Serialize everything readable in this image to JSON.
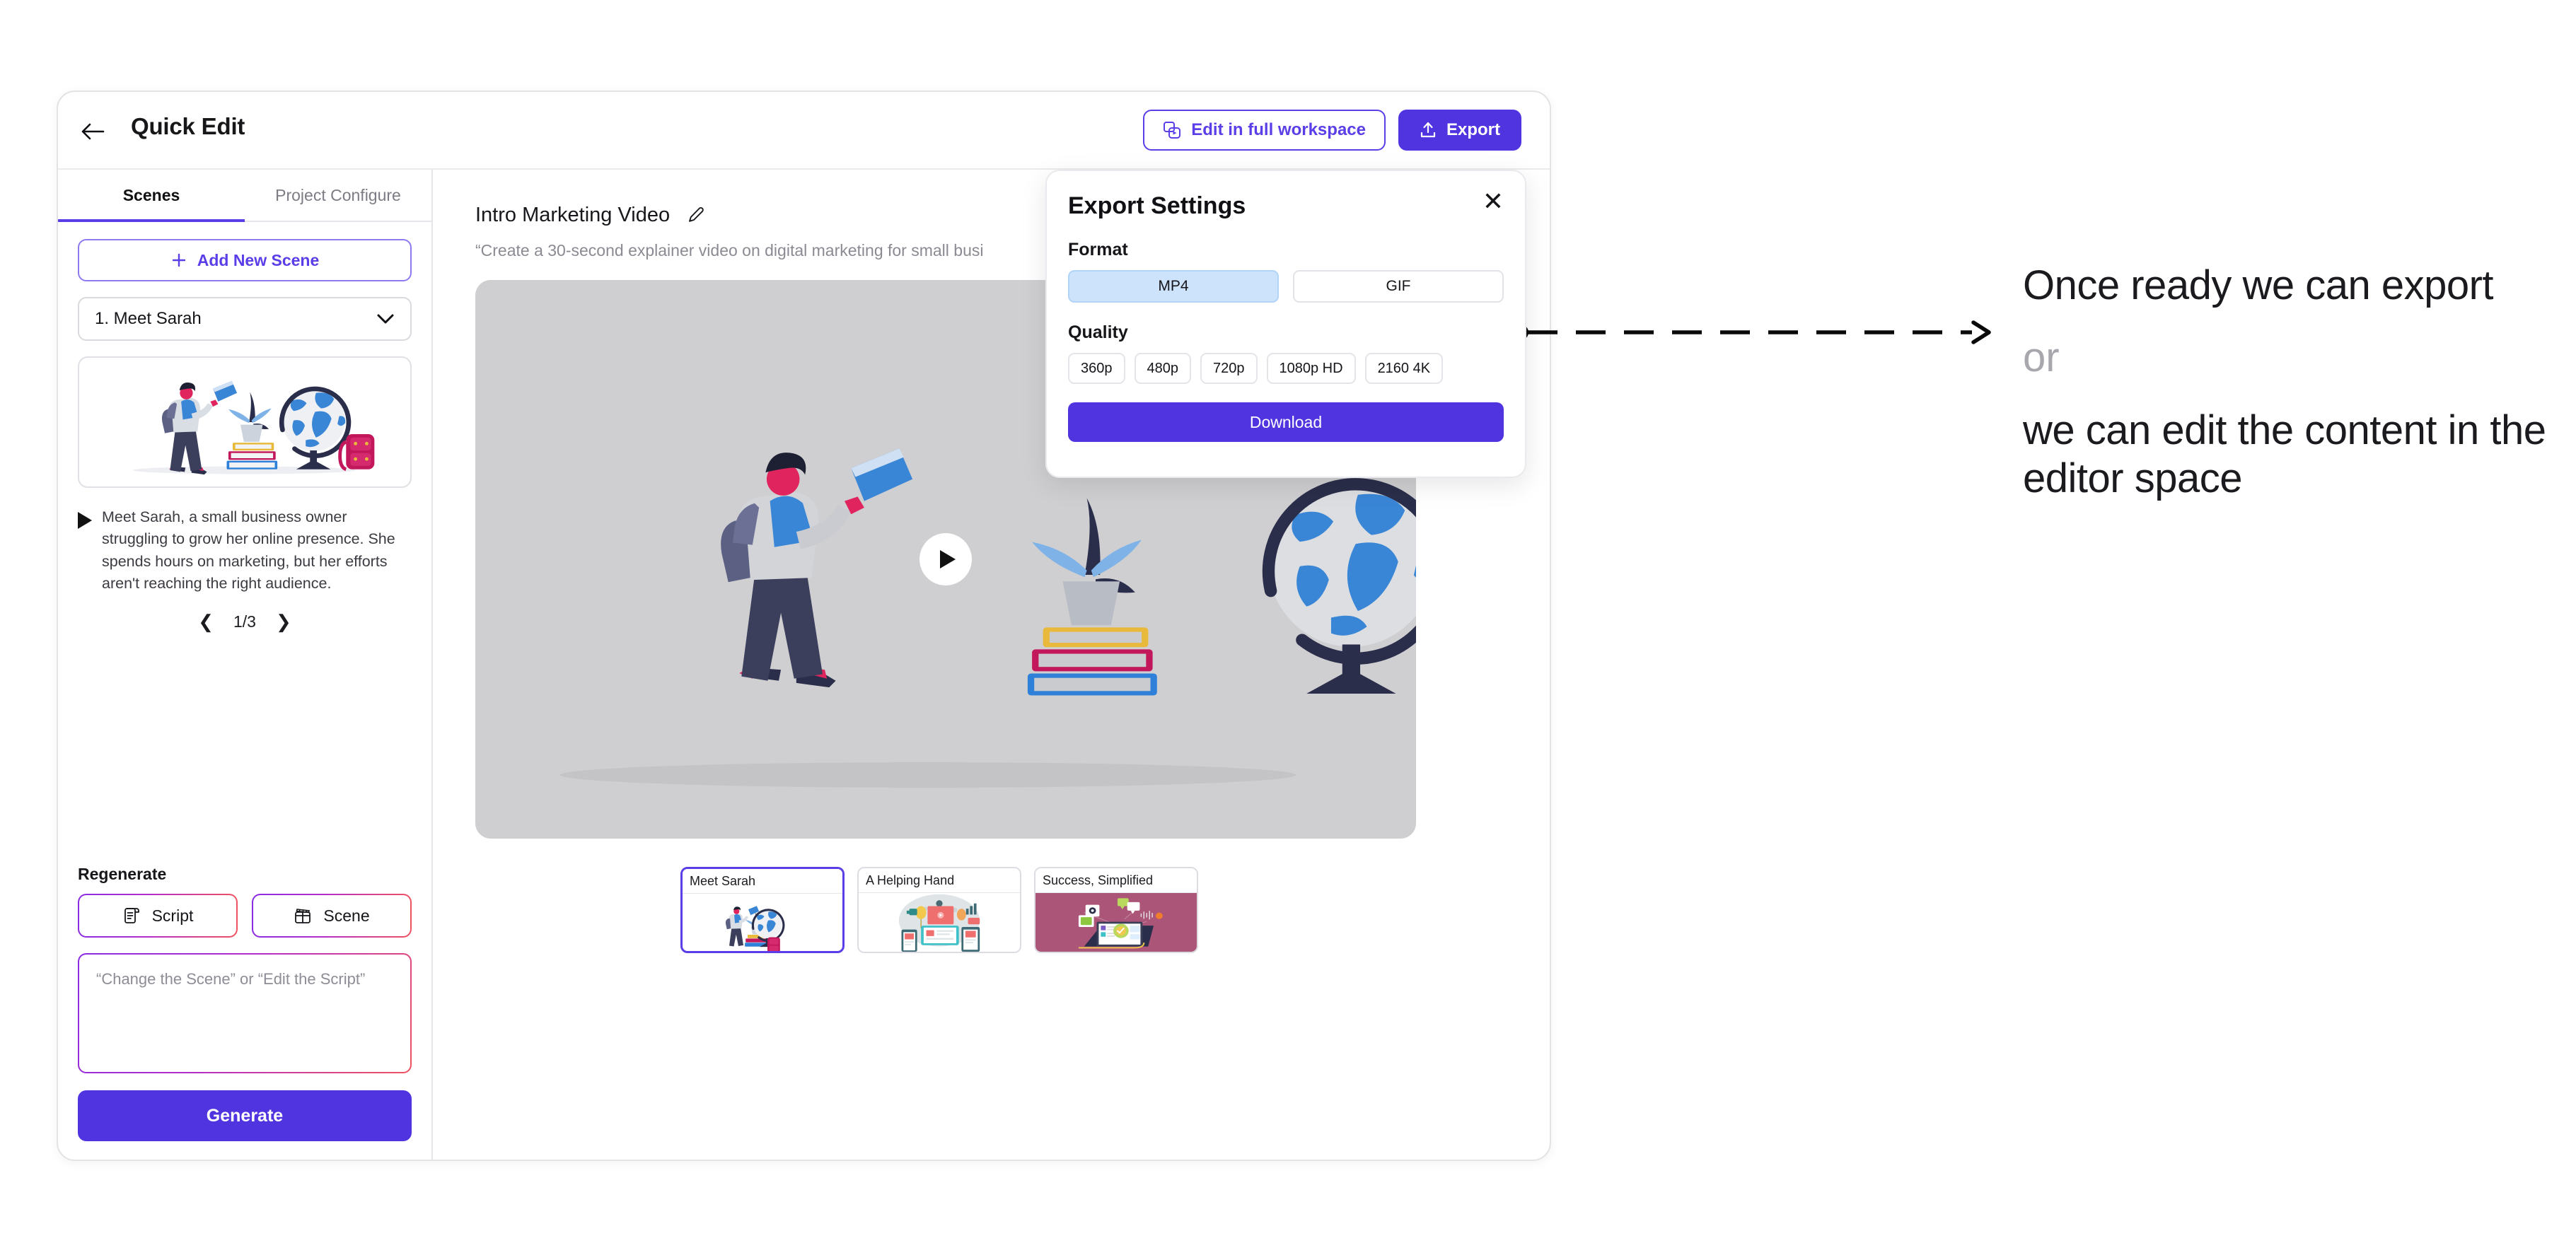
{
  "header": {
    "title": "Quick Edit",
    "back_icon": "arrow-left-icon",
    "edit_workspace_label": "Edit in full workspace",
    "edit_workspace_icon": "layers-play-icon",
    "export_label": "Export",
    "export_icon": "upload-icon"
  },
  "sidebar": {
    "tabs": [
      {
        "label": "Scenes",
        "active": true
      },
      {
        "label": "Project Configure",
        "active": false
      }
    ],
    "add_scene_label": "Add New Scene",
    "add_scene_icon": "plus-icon",
    "scene_select_value": "1. Meet Sarah",
    "scene_select_icon": "chevron-down-icon",
    "script_play_icon": "play-triangle-icon",
    "script_text": "Meet Sarah, a small business owner struggling to grow her online presence. She spends hours on marketing, but her efforts aren't reaching the right audience.",
    "pager": {
      "prev_icon": "chevron-left-icon",
      "next_icon": "chevron-right-icon",
      "counter": "1/3"
    },
    "regenerate_label": "Regenerate",
    "regen_buttons": [
      {
        "label": "Script",
        "icon": "script-scroll-icon"
      },
      {
        "label": "Scene",
        "icon": "clapperboard-icon"
      }
    ],
    "prompt_placeholder": "“Change the Scene” or “Edit the Script”",
    "generate_label": "Generate"
  },
  "stage": {
    "video_title": "Intro Marketing Video",
    "title_edit_icon": "pencil-edit-icon",
    "video_subtitle": "“Create a 30-second explainer video on digital marketing for small busi",
    "play_icon": "play-circle-icon",
    "scenes": [
      {
        "caption": "Meet Sarah",
        "selected": true
      },
      {
        "caption": "A Helping Hand",
        "selected": false
      },
      {
        "caption": "Success, Simplified",
        "selected": false
      }
    ]
  },
  "export_modal": {
    "title": "Export Settings",
    "close_icon": "close-x-icon",
    "format_label": "Format",
    "formats": [
      {
        "label": "MP4",
        "selected": true
      },
      {
        "label": "GIF",
        "selected": false
      }
    ],
    "quality_label": "Quality",
    "qualities": [
      {
        "label": "360p",
        "selected": false
      },
      {
        "label": "480p",
        "selected": false
      },
      {
        "label": "720p",
        "selected": false
      },
      {
        "label": "1080p HD",
        "selected": false
      },
      {
        "label": "2160 4K",
        "selected": false
      }
    ],
    "download_label": "Download"
  },
  "annotation": {
    "line1": "Once ready we can export",
    "or": "or",
    "line2": "we can edit the content in the editor space",
    "connector_icon": "dashed-arrow-right-icon"
  },
  "colors": {
    "accent": "#4f34e0",
    "accent_light": "#5b3ee8",
    "format_selected_bg": "#cde2fb",
    "player_bg": "#cfcfd1",
    "muted_text": "#8a8a92"
  }
}
